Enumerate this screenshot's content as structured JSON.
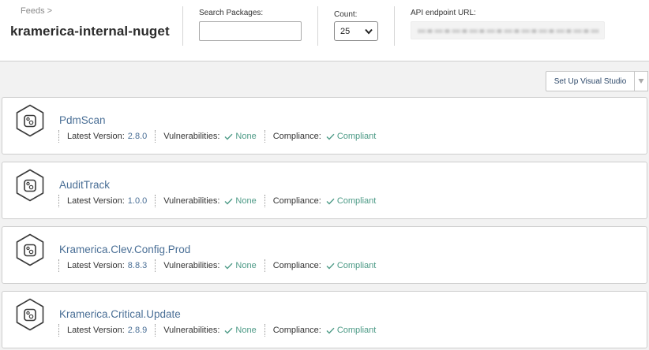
{
  "header": {
    "breadcrumb": "Feeds >",
    "title": "kramerica-internal-nuget",
    "search": {
      "label": "Search Packages:",
      "value": "",
      "placeholder": ""
    },
    "count": {
      "label": "Count:",
      "value": "25"
    },
    "api": {
      "label": "API endpoint URL:"
    }
  },
  "toolbar": {
    "setup_label": "Set Up Visual Studio"
  },
  "labels": {
    "latest_version": "Latest Version:",
    "vulnerabilities": "Vulnerabilities:",
    "compliance": "Compliance:"
  },
  "packages": [
    {
      "name": "PdmScan",
      "version": "2.8.0",
      "vulnerabilities": "None",
      "compliance": "Compliant"
    },
    {
      "name": "AuditTrack",
      "version": "1.0.0",
      "vulnerabilities": "None",
      "compliance": "Compliant"
    },
    {
      "name": "Kramerica.Clev.Config.Prod",
      "version": "8.8.3",
      "vulnerabilities": "None",
      "compliance": "Compliant"
    },
    {
      "name": "Kramerica.Critical.Update",
      "version": "2.8.9",
      "vulnerabilities": "None",
      "compliance": "Compliant"
    }
  ],
  "colors": {
    "link": "#4a6f96",
    "ok": "#4c9a86",
    "background": "#f2f2f2"
  },
  "icons": {
    "package": "hexagon-package-icon",
    "check": "check-icon",
    "dropdown": "chevron-down-icon"
  }
}
